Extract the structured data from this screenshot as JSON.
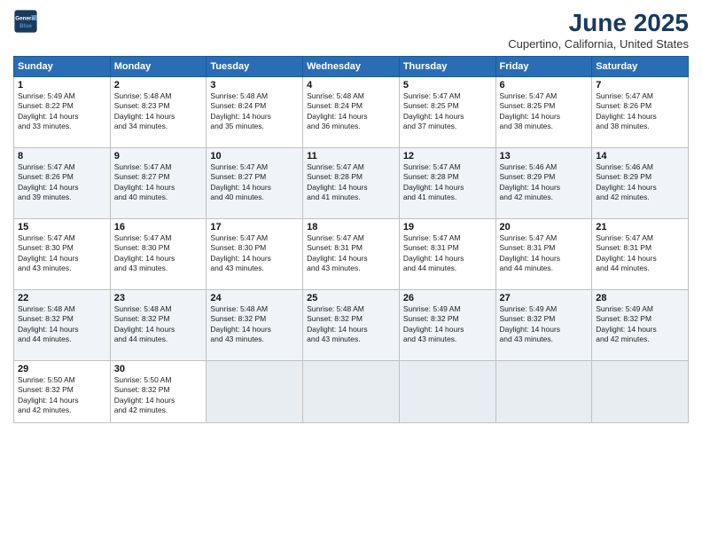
{
  "logo": {
    "line1": "General",
    "line2": "Blue"
  },
  "title": "June 2025",
  "location": "Cupertino, California, United States",
  "days_header": [
    "Sunday",
    "Monday",
    "Tuesday",
    "Wednesday",
    "Thursday",
    "Friday",
    "Saturday"
  ],
  "weeks": [
    [
      {
        "day": "1",
        "lines": [
          "Sunrise: 5:49 AM",
          "Sunset: 8:22 PM",
          "Daylight: 14 hours",
          "and 33 minutes."
        ]
      },
      {
        "day": "2",
        "lines": [
          "Sunrise: 5:48 AM",
          "Sunset: 8:23 PM",
          "Daylight: 14 hours",
          "and 34 minutes."
        ]
      },
      {
        "day": "3",
        "lines": [
          "Sunrise: 5:48 AM",
          "Sunset: 8:24 PM",
          "Daylight: 14 hours",
          "and 35 minutes."
        ]
      },
      {
        "day": "4",
        "lines": [
          "Sunrise: 5:48 AM",
          "Sunset: 8:24 PM",
          "Daylight: 14 hours",
          "and 36 minutes."
        ]
      },
      {
        "day": "5",
        "lines": [
          "Sunrise: 5:47 AM",
          "Sunset: 8:25 PM",
          "Daylight: 14 hours",
          "and 37 minutes."
        ]
      },
      {
        "day": "6",
        "lines": [
          "Sunrise: 5:47 AM",
          "Sunset: 8:25 PM",
          "Daylight: 14 hours",
          "and 38 minutes."
        ]
      },
      {
        "day": "7",
        "lines": [
          "Sunrise: 5:47 AM",
          "Sunset: 8:26 PM",
          "Daylight: 14 hours",
          "and 38 minutes."
        ]
      }
    ],
    [
      {
        "day": "8",
        "lines": [
          "Sunrise: 5:47 AM",
          "Sunset: 8:26 PM",
          "Daylight: 14 hours",
          "and 39 minutes."
        ]
      },
      {
        "day": "9",
        "lines": [
          "Sunrise: 5:47 AM",
          "Sunset: 8:27 PM",
          "Daylight: 14 hours",
          "and 40 minutes."
        ]
      },
      {
        "day": "10",
        "lines": [
          "Sunrise: 5:47 AM",
          "Sunset: 8:27 PM",
          "Daylight: 14 hours",
          "and 40 minutes."
        ]
      },
      {
        "day": "11",
        "lines": [
          "Sunrise: 5:47 AM",
          "Sunset: 8:28 PM",
          "Daylight: 14 hours",
          "and 41 minutes."
        ]
      },
      {
        "day": "12",
        "lines": [
          "Sunrise: 5:47 AM",
          "Sunset: 8:28 PM",
          "Daylight: 14 hours",
          "and 41 minutes."
        ]
      },
      {
        "day": "13",
        "lines": [
          "Sunrise: 5:46 AM",
          "Sunset: 8:29 PM",
          "Daylight: 14 hours",
          "and 42 minutes."
        ]
      },
      {
        "day": "14",
        "lines": [
          "Sunrise: 5:46 AM",
          "Sunset: 8:29 PM",
          "Daylight: 14 hours",
          "and 42 minutes."
        ]
      }
    ],
    [
      {
        "day": "15",
        "lines": [
          "Sunrise: 5:47 AM",
          "Sunset: 8:30 PM",
          "Daylight: 14 hours",
          "and 43 minutes."
        ]
      },
      {
        "day": "16",
        "lines": [
          "Sunrise: 5:47 AM",
          "Sunset: 8:30 PM",
          "Daylight: 14 hours",
          "and 43 minutes."
        ]
      },
      {
        "day": "17",
        "lines": [
          "Sunrise: 5:47 AM",
          "Sunset: 8:30 PM",
          "Daylight: 14 hours",
          "and 43 minutes."
        ]
      },
      {
        "day": "18",
        "lines": [
          "Sunrise: 5:47 AM",
          "Sunset: 8:31 PM",
          "Daylight: 14 hours",
          "and 43 minutes."
        ]
      },
      {
        "day": "19",
        "lines": [
          "Sunrise: 5:47 AM",
          "Sunset: 8:31 PM",
          "Daylight: 14 hours",
          "and 44 minutes."
        ]
      },
      {
        "day": "20",
        "lines": [
          "Sunrise: 5:47 AM",
          "Sunset: 8:31 PM",
          "Daylight: 14 hours",
          "and 44 minutes."
        ]
      },
      {
        "day": "21",
        "lines": [
          "Sunrise: 5:47 AM",
          "Sunset: 8:31 PM",
          "Daylight: 14 hours",
          "and 44 minutes."
        ]
      }
    ],
    [
      {
        "day": "22",
        "lines": [
          "Sunrise: 5:48 AM",
          "Sunset: 8:32 PM",
          "Daylight: 14 hours",
          "and 44 minutes."
        ]
      },
      {
        "day": "23",
        "lines": [
          "Sunrise: 5:48 AM",
          "Sunset: 8:32 PM",
          "Daylight: 14 hours",
          "and 44 minutes."
        ]
      },
      {
        "day": "24",
        "lines": [
          "Sunrise: 5:48 AM",
          "Sunset: 8:32 PM",
          "Daylight: 14 hours",
          "and 43 minutes."
        ]
      },
      {
        "day": "25",
        "lines": [
          "Sunrise: 5:48 AM",
          "Sunset: 8:32 PM",
          "Daylight: 14 hours",
          "and 43 minutes."
        ]
      },
      {
        "day": "26",
        "lines": [
          "Sunrise: 5:49 AM",
          "Sunset: 8:32 PM",
          "Daylight: 14 hours",
          "and 43 minutes."
        ]
      },
      {
        "day": "27",
        "lines": [
          "Sunrise: 5:49 AM",
          "Sunset: 8:32 PM",
          "Daylight: 14 hours",
          "and 43 minutes."
        ]
      },
      {
        "day": "28",
        "lines": [
          "Sunrise: 5:49 AM",
          "Sunset: 8:32 PM",
          "Daylight: 14 hours",
          "and 42 minutes."
        ]
      }
    ],
    [
      {
        "day": "29",
        "lines": [
          "Sunrise: 5:50 AM",
          "Sunset: 8:32 PM",
          "Daylight: 14 hours",
          "and 42 minutes."
        ]
      },
      {
        "day": "30",
        "lines": [
          "Sunrise: 5:50 AM",
          "Sunset: 8:32 PM",
          "Daylight: 14 hours",
          "and 42 minutes."
        ]
      },
      {
        "day": "",
        "lines": []
      },
      {
        "day": "",
        "lines": []
      },
      {
        "day": "",
        "lines": []
      },
      {
        "day": "",
        "lines": []
      },
      {
        "day": "",
        "lines": []
      }
    ]
  ]
}
